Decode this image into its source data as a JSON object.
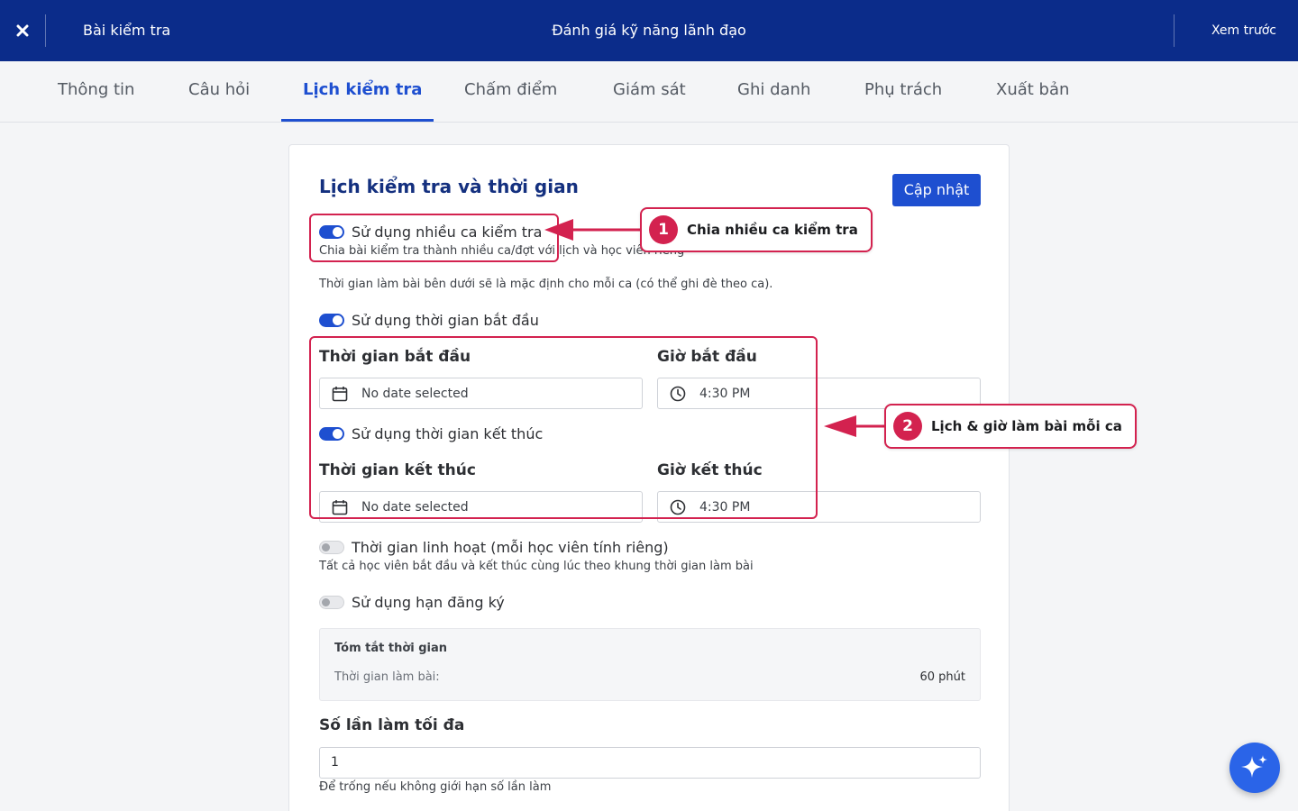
{
  "topbar": {
    "close_icon": "close-icon",
    "left_title": "Bài kiểm tra",
    "center_title": "Đánh giá kỹ năng lãnh đạo",
    "preview_label": "Xem trước",
    "background_color": "#0b2c8a"
  },
  "tabs": [
    {
      "label": "Thông tin",
      "active": false
    },
    {
      "label": "Câu hỏi",
      "active": false
    },
    {
      "label": "Lịch kiểm tra",
      "active": true
    },
    {
      "label": "Chấm điểm",
      "active": false
    },
    {
      "label": "Giám sát",
      "active": false
    },
    {
      "label": "Ghi danh",
      "active": false
    },
    {
      "label": "Phụ trách",
      "active": false
    },
    {
      "label": "Xuất bản",
      "active": false
    }
  ],
  "card": {
    "title": "Lịch kiểm tra và thời gian",
    "update_label": "Cập nhật",
    "multi_session": {
      "label": "Sử dụng nhiều ca kiểm tra",
      "enabled": true,
      "helper": "Chia bài kiểm tra thành nhiều ca/đợt với lịch và học viên riêng"
    },
    "default_note": "Thời gian làm bài bên dưới sẽ là mặc định cho mỗi ca (có thể ghi đè theo ca).",
    "use_start": {
      "label": "Sử dụng thời gian bắt đầu",
      "enabled": true
    },
    "start_date": {
      "label": "Thời gian bắt đầu",
      "value": "No date selected"
    },
    "start_time": {
      "label": "Giờ bắt đầu",
      "value": "4:30 PM"
    },
    "use_end": {
      "label": "Sử dụng thời gian kết thúc",
      "enabled": true
    },
    "end_date": {
      "label": "Thời gian kết thúc",
      "value": "No date selected"
    },
    "end_time": {
      "label": "Giờ kết thúc",
      "value": "4:30 PM"
    },
    "flexible": {
      "label": "Thời gian linh hoạt (mỗi học viên tính riêng)",
      "enabled": false,
      "helper": "Tất cả học viên bắt đầu và kết thúc cùng lúc theo khung thời gian làm bài"
    },
    "registration_deadline": {
      "label": "Sử dụng hạn đăng ký",
      "enabled": false
    },
    "summary": {
      "title": "Tóm tắt thời gian",
      "duration_key": "Thời gian làm bài:",
      "duration_value": "60 phút"
    },
    "max_attempts": {
      "label": "Số lần làm tối đa",
      "value": "1",
      "helper": "Để trống nếu không giới hạn số lần làm"
    }
  },
  "annotations": [
    {
      "number": "1",
      "text": "Chia nhiều ca kiểm tra"
    },
    {
      "number": "2",
      "text": "Lịch & giờ làm bài mỗi ca"
    }
  ],
  "colors": {
    "accent": "#1e4fd0",
    "annotation": "#d3224f",
    "fab": "#2a64e8"
  },
  "fab_icon": "sparkle-icon"
}
